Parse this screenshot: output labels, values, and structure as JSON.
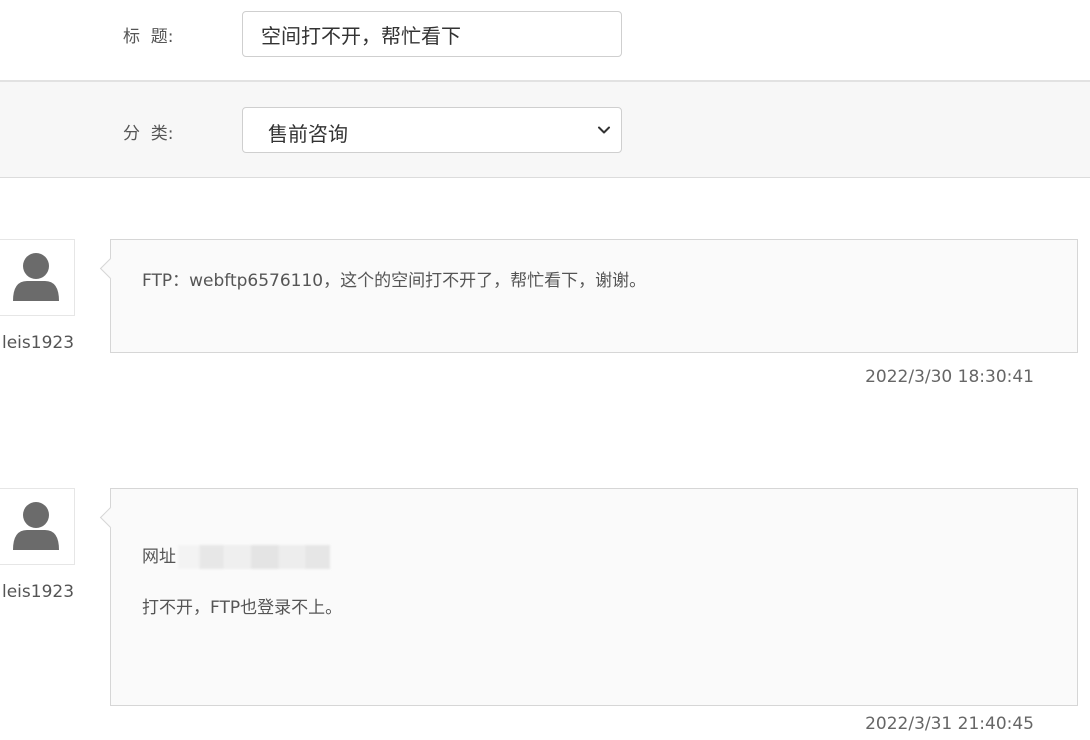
{
  "form": {
    "title_label": "标  题:",
    "title_value": "空间打不开，帮忙看下",
    "category_label": "分  类:",
    "category_value": "售前咨询"
  },
  "messages": [
    {
      "username": "leis1923",
      "text": "FTP：webftp6576110，这个的空间打不开了，帮忙看下，谢谢。",
      "timestamp": "2022/3/30 18:30:41"
    },
    {
      "username": "leis1923",
      "line1": "网址",
      "line2": "打不开，FTP也登录不上。",
      "timestamp": "2022/3/31 21:40:45"
    }
  ],
  "icons": {
    "avatar": "user-avatar-icon",
    "select": "chevron-down-icon"
  },
  "colors": {
    "avatar": "#6b6b6b",
    "bubble_bg": "#fafafa",
    "border": "#d6d6d6"
  }
}
